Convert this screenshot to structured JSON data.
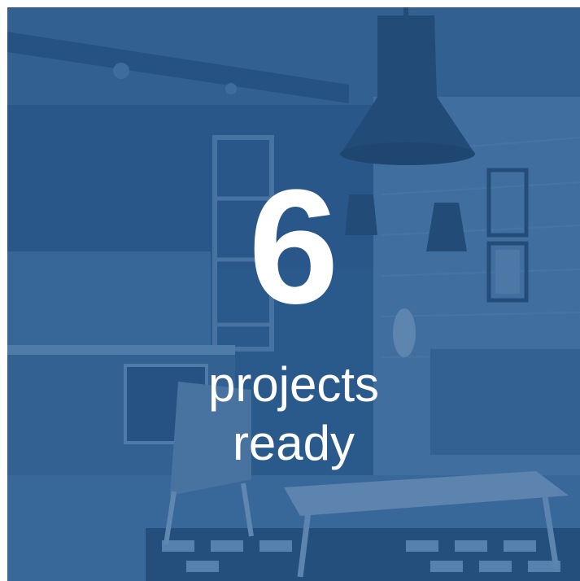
{
  "stat": {
    "number": "6",
    "caption_line1": "projects",
    "caption_line2": "ready"
  },
  "colors": {
    "overlay": "#2e5d8c",
    "text": "#ffffff"
  },
  "background": {
    "icon": "interior-kitchen-living-room-photo"
  }
}
